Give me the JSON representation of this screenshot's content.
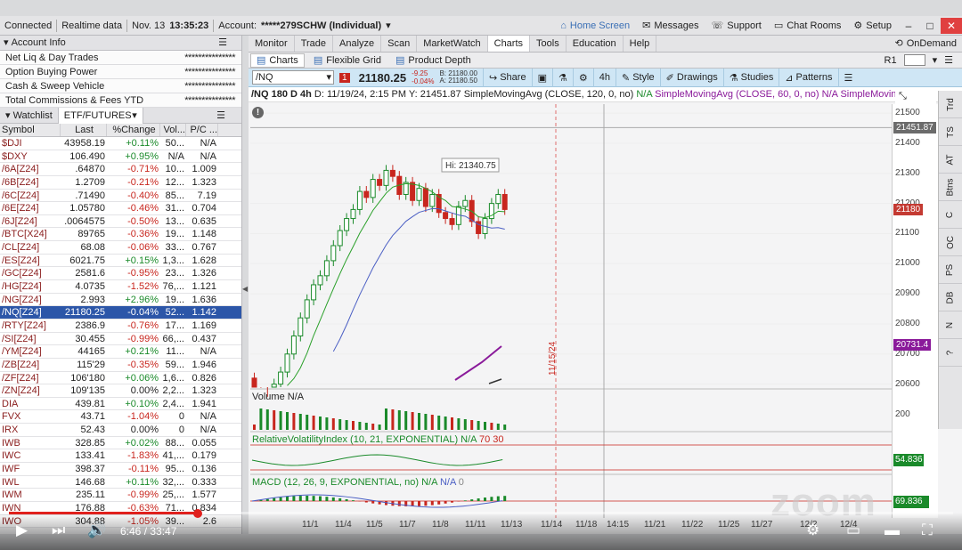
{
  "topbar": {
    "connected": "Connected",
    "realtime": "Realtime data",
    "date": "Nov. 13",
    "time": "13:35:23",
    "account_label": "Account:",
    "account_value": "*****279SCHW (Individual)",
    "home_screen": "Home Screen",
    "messages": "Messages",
    "support": "Support",
    "chat_rooms": "Chat Rooms",
    "setup": "Setup"
  },
  "account_info": {
    "title": "Account Info",
    "rows": [
      {
        "label": "Net Liq & Day Trades",
        "value": "***************"
      },
      {
        "label": "Option Buying Power",
        "value": "***************"
      },
      {
        "label": "Cash & Sweep Vehicle",
        "value": "***************"
      },
      {
        "label": "Total Commissions & Fees YTD",
        "value": "***************"
      }
    ]
  },
  "watchlist": {
    "tab1": "Watchlist",
    "tab2": "ETF/FUTURES",
    "columns": [
      "Symbol",
      "Last",
      "%Change",
      "Vol...",
      "P/C ..."
    ],
    "rows": [
      [
        "$DJI",
        "43958.19",
        "+0.11%",
        "50...",
        "N/A"
      ],
      [
        "$DXY",
        "106.490",
        "+0.95%",
        "N/A",
        "N/A"
      ],
      [
        "/6A[Z24]",
        ".64870",
        "-0.71%",
        "10...",
        "1.009"
      ],
      [
        "/6B[Z24]",
        "1.2709",
        "-0.21%",
        "12...",
        "1.323"
      ],
      [
        "/6C[Z24]",
        ".71490",
        "-0.40%",
        "85...",
        "7.19"
      ],
      [
        "/6E[Z24]",
        "1.05780",
        "-0.46%",
        "31...",
        "0.704"
      ],
      [
        "/6J[Z24]",
        ".0064575",
        "-0.50%",
        "13...",
        "0.635"
      ],
      [
        "/BTC[X24]",
        "89765",
        "-0.36%",
        "19...",
        "1.148"
      ],
      [
        "/CL[Z24]",
        "68.08",
        "-0.06%",
        "33...",
        "0.767"
      ],
      [
        "/ES[Z24]",
        "6021.75",
        "+0.15%",
        "1,3...",
        "1.628"
      ],
      [
        "/GC[Z24]",
        "2581.6",
        "-0.95%",
        "23...",
        "1.326"
      ],
      [
        "/HG[Z24]",
        "4.0735",
        "-1.52%",
        "76,...",
        "1.121"
      ],
      [
        "/NG[Z24]",
        "2.993",
        "+2.96%",
        "19...",
        "1.636"
      ],
      [
        "/NQ[Z24]",
        "21180.25",
        "-0.04%",
        "52...",
        "1.142"
      ],
      [
        "/RTY[Z24]",
        "2386.9",
        "-0.76%",
        "17...",
        "1.169"
      ],
      [
        "/SI[Z24]",
        "30.455",
        "-0.99%",
        "66,...",
        "0.437"
      ],
      [
        "/YM[Z24]",
        "44165",
        "+0.21%",
        "11...",
        "N/A"
      ],
      [
        "/ZB[Z24]",
        "115'29",
        "-0.35%",
        "59...",
        "1.946"
      ],
      [
        "/ZF[Z24]",
        "106'180",
        "+0.06%",
        "1,6...",
        "0.826"
      ],
      [
        "/ZN[Z24]",
        "109'135",
        "0.00%",
        "2,2...",
        "1.323"
      ],
      [
        "DIA",
        "439.81",
        "+0.10%",
        "2,4...",
        "1.941"
      ],
      [
        "FVX",
        "43.71",
        "-1.04%",
        "0",
        "N/A"
      ],
      [
        "IRX",
        "52.43",
        "0.00%",
        "0",
        "N/A"
      ],
      [
        "IWB",
        "328.85",
        "+0.02%",
        "88...",
        "0.055"
      ],
      [
        "IWC",
        "133.41",
        "-1.83%",
        "41,...",
        "0.179"
      ],
      [
        "IWF",
        "398.37",
        "-0.11%",
        "95...",
        "0.136"
      ],
      [
        "IWL",
        "146.68",
        "+0.11%",
        "32,...",
        "0.333"
      ],
      [
        "IWM",
        "235.11",
        "-0.99%",
        "25,...",
        "1.577"
      ],
      [
        "IWN",
        "176.88",
        "-0.63%",
        "71...",
        "0.834"
      ],
      [
        "IWO",
        "304.88",
        "-1.05%",
        "39...",
        "2.6"
      ]
    ]
  },
  "nav": {
    "tabs": [
      "Monitor",
      "Trade",
      "Analyze",
      "Scan",
      "MarketWatch",
      "Charts",
      "Tools",
      "Education",
      "Help"
    ],
    "ondemand": "OnDemand",
    "subtabs": [
      "Charts",
      "Flexible Grid",
      "Product Depth"
    ],
    "r1": "R1"
  },
  "toolbar": {
    "symbol": "/NQ",
    "price": "21180.25",
    "change": "-9.25",
    "change_pct": "-0.04%",
    "bid": "B: 21180.00",
    "ask": "A: 21180.50",
    "share": "Share",
    "interval": "4h",
    "style": "Style",
    "drawings": "Drawings",
    "studies": "Studies",
    "patterns": "Patterns"
  },
  "studyline": {
    "title": "/NQ 180 D 4h",
    "date": "D: 11/19/24, 2:15 PM",
    "y": "Y: 21451.87",
    "sma120": "SimpleMovingAvg (CLOSE, 120, 0, no)",
    "na1": "N/A",
    "sma60": "SimpleMovingAvg (CLOSE, 60, 0, no)",
    "na2": "N/A",
    "sma_more": "SimpleMoving..."
  },
  "chart_data": {
    "type": "candlestick",
    "title": "/NQ 180 D 4h",
    "hi_label": "Hi: 21340.75",
    "date_marker": "11/15/24",
    "yticks": [
      "21500",
      "21400",
      "21300",
      "21200",
      "21100",
      "21000",
      "20900",
      "20800",
      "20700",
      "20600"
    ],
    "price_tags": [
      {
        "label": "21451.87",
        "color": "#6b6b6b"
      },
      {
        "label": "21180",
        "color": "#c43a32"
      },
      {
        "label": "20731.4",
        "color": "#8a1a9a"
      }
    ],
    "xticks": [
      "11/1",
      "11/4",
      "11/5",
      "11/7",
      "11/8",
      "11/11",
      "11/13",
      "11/14",
      "11/18",
      "14:15",
      "11/21",
      "11/22",
      "11/25",
      "11/27",
      "12/2",
      "12/4"
    ],
    "closes": [
      20570,
      20540,
      20520,
      20600,
      20640,
      20700,
      20760,
      20820,
      20880,
      20930,
      20960,
      21010,
      21060,
      21110,
      21150,
      21180,
      21240,
      21220,
      21280,
      21260,
      21310,
      21290,
      21230,
      21270,
      21210,
      21250,
      21190,
      21230,
      21170,
      21150,
      21130,
      21190,
      21210,
      21140,
      21100,
      21150,
      21200,
      21230,
      21180
    ]
  },
  "volume": {
    "label": "Volume",
    "na": "N/A",
    "ytick": "200"
  },
  "rvi": {
    "label": "RelativeVolatilityIndex (10, 21, EXPONENTIAL)",
    "na": "N/A",
    "v1": "70",
    "v2": "30",
    "value": "54.836"
  },
  "macd": {
    "label": "MACD (12, 26, 9, EXPONENTIAL, no)",
    "na": "N/A",
    "na2": "N/A",
    "zero": "0",
    "value": "69.836"
  },
  "sidetabs": [
    "Trd",
    "TS",
    "AT",
    "Btns",
    "C",
    "OC",
    "PS",
    "DB",
    "N",
    "?"
  ],
  "video": {
    "time": "6:46 / 33:47",
    "progress_pct": 20
  },
  "watermark": "zoom"
}
